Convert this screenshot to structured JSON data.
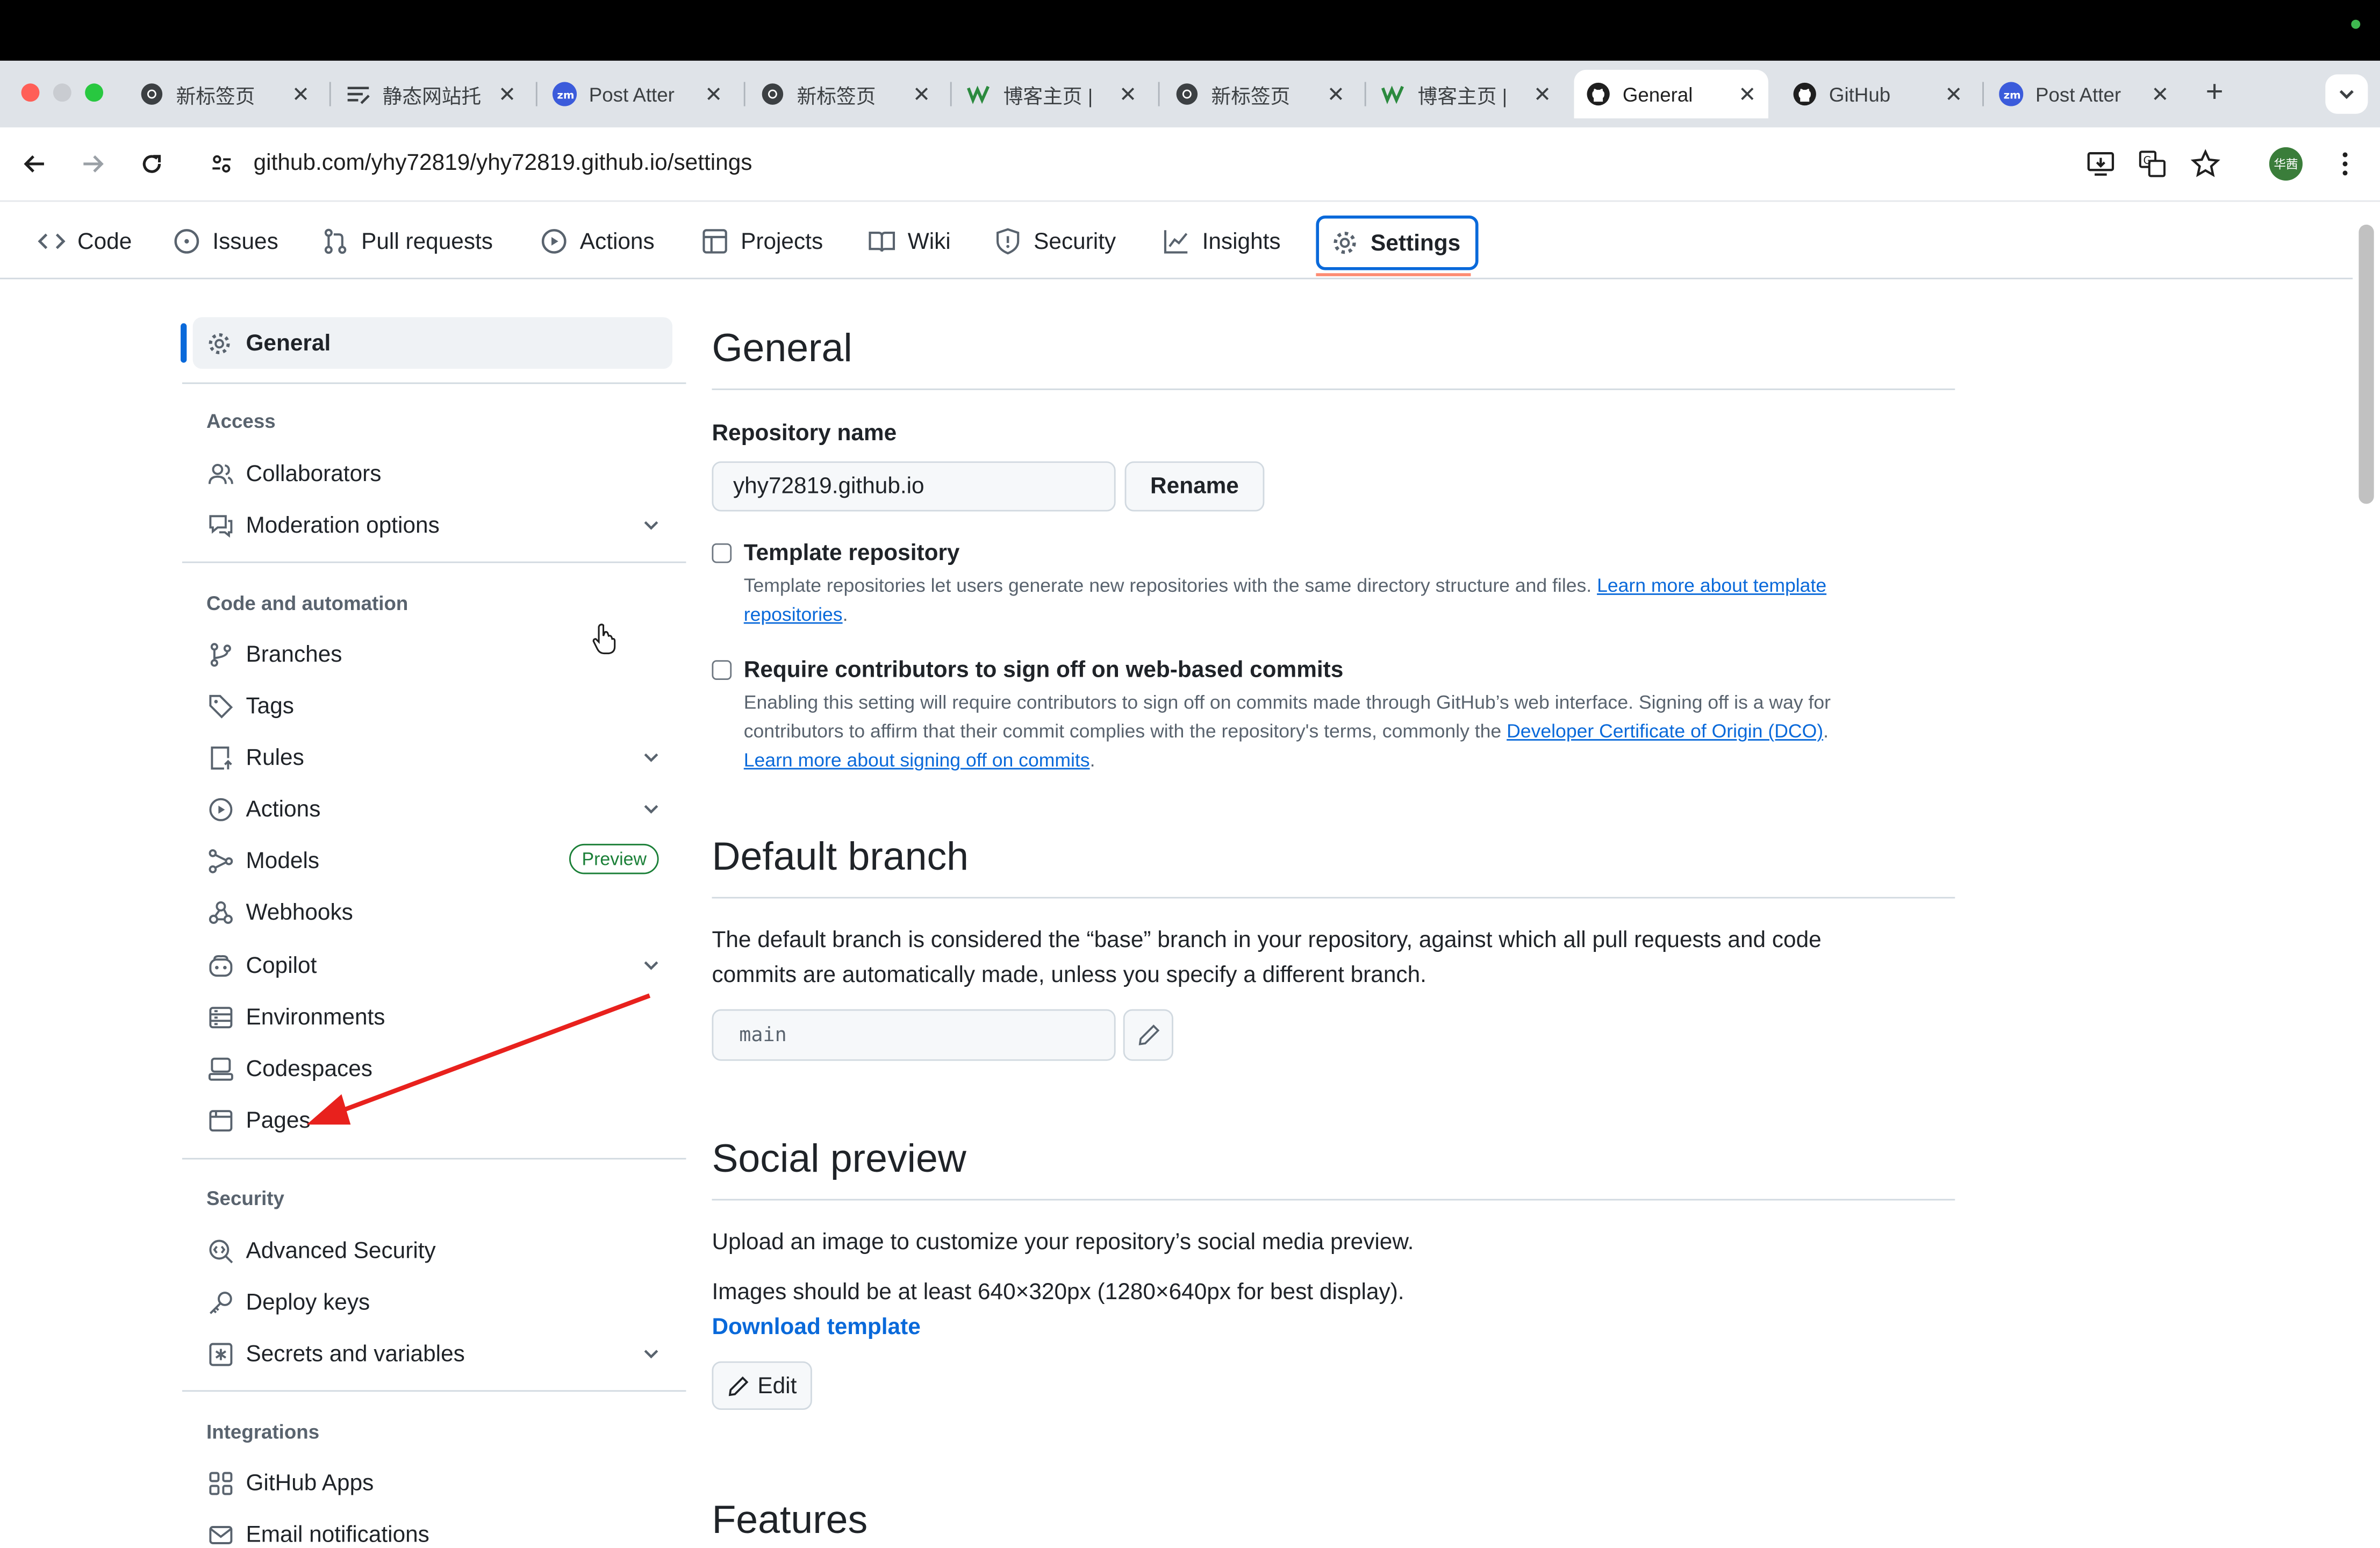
{
  "browser": {
    "tabs": [
      {
        "title": "新标签页",
        "icon": "chrome-icon",
        "active": false
      },
      {
        "title": "静态网站托",
        "icon": "docs-icon",
        "active": false
      },
      {
        "title": "Post Atter",
        "icon": "zm-icon",
        "active": false
      },
      {
        "title": "新标签页",
        "icon": "chrome-icon",
        "active": false
      },
      {
        "title": "博客主页 |",
        "icon": "w-icon",
        "active": false
      },
      {
        "title": "新标签页",
        "icon": "chrome-icon",
        "active": false
      },
      {
        "title": "博客主页 |",
        "icon": "w-icon",
        "active": false
      },
      {
        "title": "General",
        "icon": "github-icon",
        "active": true
      },
      {
        "title": "GitHub",
        "icon": "github-icon",
        "active": false
      },
      {
        "title": "Post Atter",
        "icon": "zm-icon",
        "active": false
      }
    ],
    "url": "github.com/yhy72819/yhy72819.github.io/settings",
    "profile_initials": "华茜",
    "zm_badge": "zm"
  },
  "repo_nav": [
    {
      "label": "Code",
      "icon": "code-icon"
    },
    {
      "label": "Issues",
      "icon": "issue-icon"
    },
    {
      "label": "Pull requests",
      "icon": "pull-request-icon"
    },
    {
      "label": "Actions",
      "icon": "play-icon"
    },
    {
      "label": "Projects",
      "icon": "table-icon"
    },
    {
      "label": "Wiki",
      "icon": "book-icon"
    },
    {
      "label": "Security",
      "icon": "shield-icon"
    },
    {
      "label": "Insights",
      "icon": "graph-icon"
    },
    {
      "label": "Settings",
      "icon": "gear-icon",
      "selected": true
    }
  ],
  "sidebar": {
    "general": "General",
    "groups": {
      "access": "Access",
      "code_automation": "Code and automation",
      "security": "Security",
      "integrations": "Integrations"
    },
    "items": {
      "collaborators": "Collaborators",
      "moderation": "Moderation options",
      "branches": "Branches",
      "tags": "Tags",
      "rules": "Rules",
      "actions": "Actions",
      "models": "Models",
      "models_badge": "Preview",
      "webhooks": "Webhooks",
      "copilot": "Copilot",
      "environments": "Environments",
      "codespaces": "Codespaces",
      "pages": "Pages",
      "advanced_security": "Advanced Security",
      "deploy_keys": "Deploy keys",
      "secrets": "Secrets and variables",
      "github_apps": "GitHub Apps",
      "email_notifications": "Email notifications"
    }
  },
  "main": {
    "general_title": "General",
    "repo_name_label": "Repository name",
    "repo_name_value": "yhy72819.github.io",
    "rename_button": "Rename",
    "template_label": "Template repository",
    "template_note": "Template repositories let users generate new repositories with the same directory structure and files.",
    "template_link_1": "Learn more about template",
    "template_link_2": "repositories",
    "signoff_label": "Require contributors to sign off on web-based commits",
    "signoff_note_1": "Enabling this setting will require contributors to sign off on commits made through GitHub’s web interface. Signing off is a way for",
    "signoff_note_2": "contributors to affirm that their commit complies with the repository's terms, commonly the",
    "signoff_link_1": "Developer Certificate of Origin (DCO)",
    "signoff_link_2": "Learn more about signing off on commits",
    "default_branch_title": "Default branch",
    "default_branch_desc_1": "The default branch is considered the “base” branch in your repository, against which all pull requests and code",
    "default_branch_desc_2": "commits are automatically made, unless you specify a different branch.",
    "default_branch_value": "main",
    "social_title": "Social preview",
    "social_desc": "Upload an image to customize your repository’s social media preview.",
    "social_size": "Images should be at least 640×320px (1280×640px for best display).",
    "download_template": "Download template",
    "edit_button": "Edit",
    "features_title": "Features"
  },
  "colors": {
    "accent": "#0969da",
    "settings_underline": "#fd8c73",
    "annotation_arrow": "#e8211d",
    "preview_badge": "#1a7f37"
  }
}
